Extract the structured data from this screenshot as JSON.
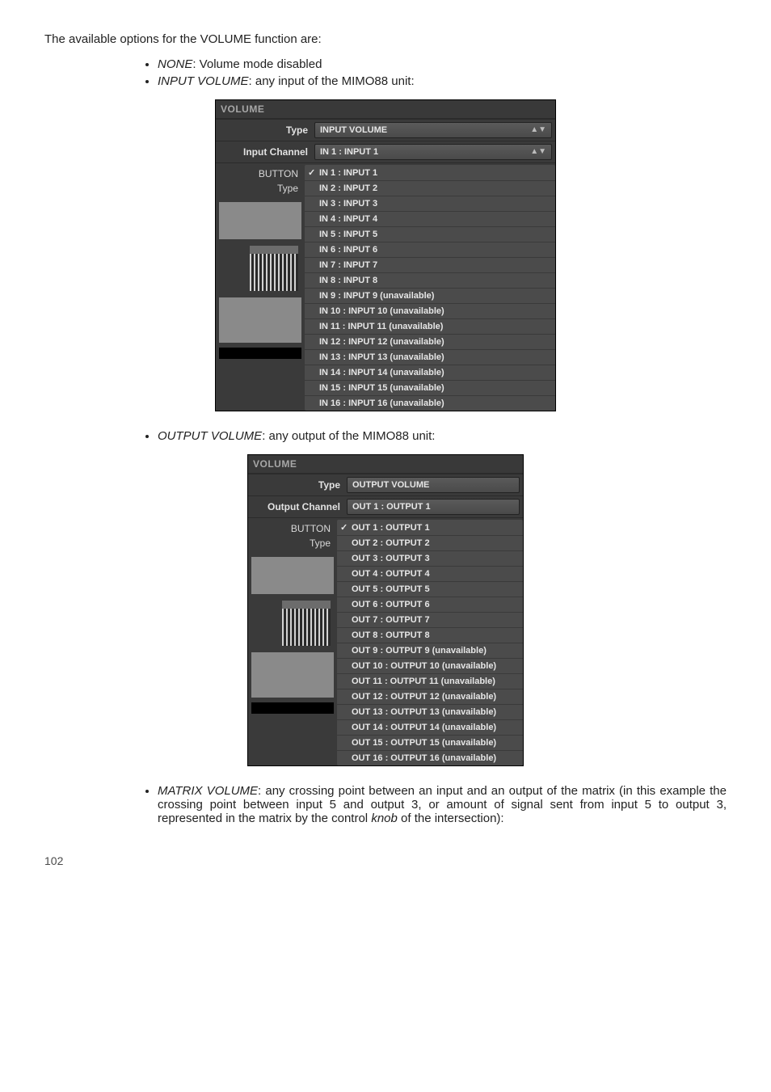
{
  "intro": "The available options for the VOLUME function are:",
  "bullets": {
    "none": {
      "label": "NONE",
      "desc": ": Volume mode disabled"
    },
    "input_volume": {
      "label": "INPUT VOLUME",
      "desc": ": any input of the MIMO88 unit:"
    },
    "output_volume": {
      "label": "OUTPUT VOLUME",
      "desc": ": any output of the MIMO88 unit:"
    },
    "matrix_volume": {
      "label": "MATRIX VOLUME",
      "desc": ": any crossing point between an input and an output of the matrix (in this example the crossing point between input 5 and output 3, or amount of signal sent from input 5 to output 3, represented in the matrix by the control ",
      "knob": "knob",
      "tail": " of the intersection):"
    }
  },
  "panel1": {
    "header": "VOLUME",
    "type_label": "Type",
    "type_value": "INPUT VOLUME",
    "channel_label": "Input Channel",
    "channel_value": "IN 1 : INPUT 1",
    "button_label": "BUTTON",
    "button_type_label": "Type",
    "options": [
      "IN 1 : INPUT 1",
      "IN 2 : INPUT 2",
      "IN 3 : INPUT 3",
      "IN 4 : INPUT 4",
      "IN 5 : INPUT 5",
      "IN 6 : INPUT 6",
      "IN 7 : INPUT 7",
      "IN 8 : INPUT 8",
      "IN 9 : INPUT 9 (unavailable)",
      "IN 10 : INPUT 10 (unavailable)",
      "IN 11 : INPUT 11 (unavailable)",
      "IN 12 : INPUT 12 (unavailable)",
      "IN 13 : INPUT 13 (unavailable)",
      "IN 14 : INPUT 14 (unavailable)",
      "IN 15 : INPUT 15 (unavailable)",
      "IN 16 : INPUT 16 (unavailable)"
    ]
  },
  "panel2": {
    "header": "VOLUME",
    "type_label": "Type",
    "type_value": "OUTPUT VOLUME",
    "channel_label": "Output Channel",
    "channel_value": "OUT 1 : OUTPUT 1",
    "button_label": "BUTTON",
    "button_type_label": "Type",
    "options": [
      "OUT 1 : OUTPUT 1",
      "OUT 2 : OUTPUT 2",
      "OUT 3 : OUTPUT 3",
      "OUT 4 : OUTPUT 4",
      "OUT 5 : OUTPUT 5",
      "OUT 6 : OUTPUT 6",
      "OUT 7 : OUTPUT 7",
      "OUT 8 : OUTPUT 8",
      "OUT 9 : OUTPUT 9 (unavailable)",
      "OUT 10 : OUTPUT 10 (unavailable)",
      "OUT 11 : OUTPUT 11 (unavailable)",
      "OUT 12 : OUTPUT 12 (unavailable)",
      "OUT 13 : OUTPUT 13 (unavailable)",
      "OUT 14 : OUTPUT 14 (unavailable)",
      "OUT 15 : OUTPUT 15 (unavailable)",
      "OUT 16 : OUTPUT 16 (unavailable)"
    ]
  },
  "page_number": "102"
}
